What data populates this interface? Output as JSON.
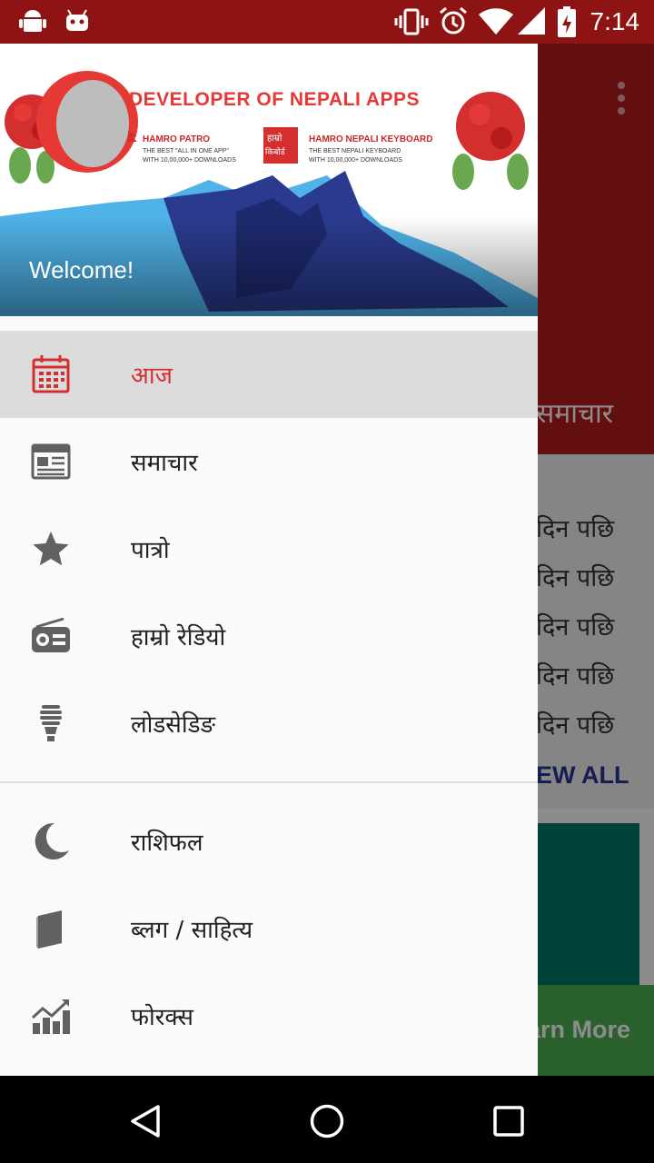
{
  "status_bar": {
    "time": "7:14",
    "icons": [
      "android-icon",
      "android-alt-icon",
      "vibrate-icon",
      "alarm-icon",
      "wifi-icon",
      "signal-icon",
      "battery-charging-icon"
    ],
    "color": "#8e1414"
  },
  "background_app": {
    "tab_label": "समाचार",
    "list_items": [
      "दिन पछि",
      "दिन पछि",
      "दिन पछि",
      "दिन पछि",
      "दिन पछि"
    ],
    "view_all": "EW ALL",
    "ad_label": "arn More"
  },
  "drawer": {
    "header": {
      "banner_title": "DEVELOPER OF NEPALI APPS",
      "app1_title": "HAMRO PATRO",
      "app1_line1": "THE BEST \"ALL IN ONE APP\"",
      "app1_line2": "WITH 10,00,000+ DOWNLOADS",
      "app2_logo1": "हाम्रो",
      "app2_logo2": "किबोर्ड",
      "app2_title": "HAMRO NEPALI KEYBOARD",
      "app2_line1": "THE BEST NEPALI KEYBOARD",
      "app2_line2": "WITH 10,00,000+ DOWNLOADS",
      "welcome": "Welcome!"
    },
    "items": [
      {
        "label": "आज",
        "icon": "calendar-icon",
        "selected": true
      },
      {
        "label": "समाचार",
        "icon": "newspaper-icon"
      },
      {
        "label": "पात्रो",
        "icon": "star-icon"
      },
      {
        "label": "हाम्रो रेडियो",
        "icon": "radio-icon"
      },
      {
        "label": "लोडसेडिङ",
        "icon": "bulb-icon"
      },
      {
        "label": "राशिफल",
        "icon": "moon-icon"
      },
      {
        "label": "ब्लग / साहित्य",
        "icon": "book-icon"
      },
      {
        "label": "फोरक्स",
        "icon": "chart-icon"
      }
    ],
    "accent": "#d32f2f"
  },
  "nav_bar": {
    "icons": [
      "back-icon",
      "home-icon",
      "recents-icon"
    ]
  }
}
